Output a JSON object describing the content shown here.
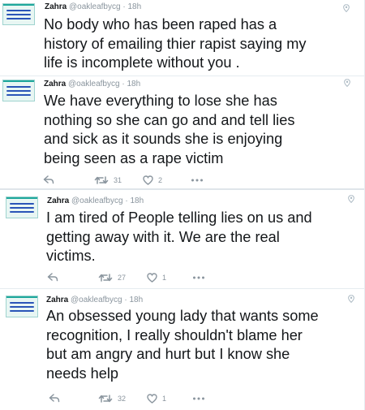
{
  "tweets": [
    {
      "name": "Zahra",
      "handle": "@oakleafbycg",
      "sep": "·",
      "time": "18h",
      "lines": [
        "No body who has been raped has a",
        "history of emailing thier rapist saying my",
        "life is incomplete without you ."
      ],
      "retweets": "",
      "likes": ""
    },
    {
      "name": "Zahra",
      "handle": "@oakleafbycg",
      "sep": "·",
      "time": "18h",
      "lines": [
        "We have everything to lose she has",
        "nothing so she can go and and tell lies",
        "and sick as it sounds she is enjoying",
        "being seen as a rape victim"
      ],
      "retweets": "31",
      "likes": "2"
    },
    {
      "name": "Zahra",
      "handle": "@oakleafbycg",
      "sep": "·",
      "time": "18h",
      "lines": [
        "I am tired of People telling lies on us and",
        "getting away with it. We are the real",
        "victims."
      ],
      "retweets": "27",
      "likes": "1"
    },
    {
      "name": "Zahra",
      "handle": "@oakleafbycg",
      "sep": "·",
      "time": "18h",
      "lines": [
        "An obsessed young lady that wants some",
        "recognition, I really shouldn't blame her",
        "but am angry and hurt but I know she",
        "needs help"
      ],
      "retweets": "32",
      "likes": "1"
    }
  ],
  "icons": {
    "reply": "reply-icon",
    "retweet": "retweet-icon",
    "like": "heart-icon",
    "more": "more-icon",
    "caret": "location-pin-icon"
  },
  "colors": {
    "text": "#14171a",
    "muted": "#8a959e",
    "divider": "#e6ecf0",
    "avatar_bg": "#e8f6f3",
    "avatar_text": "#2a55b8"
  }
}
